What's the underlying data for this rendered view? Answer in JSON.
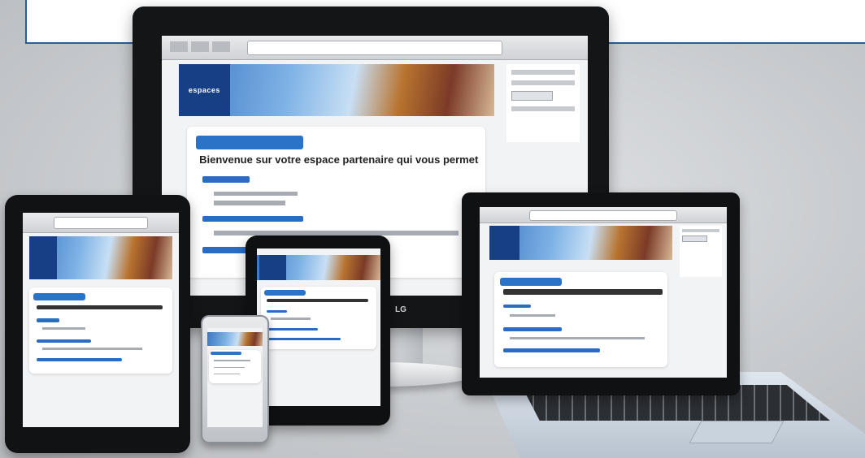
{
  "scene": {
    "description_free": true
  },
  "site": {
    "logo_text": "espaces",
    "section_badge": "",
    "heading": "Bienvenue sur votre espace partenaire qui vous permet de :",
    "brand_monitor": "LG"
  },
  "colors": {
    "frame_border": "#2a5e96",
    "site_blue": "#2a73c7",
    "logo_blue": "#173f86"
  }
}
